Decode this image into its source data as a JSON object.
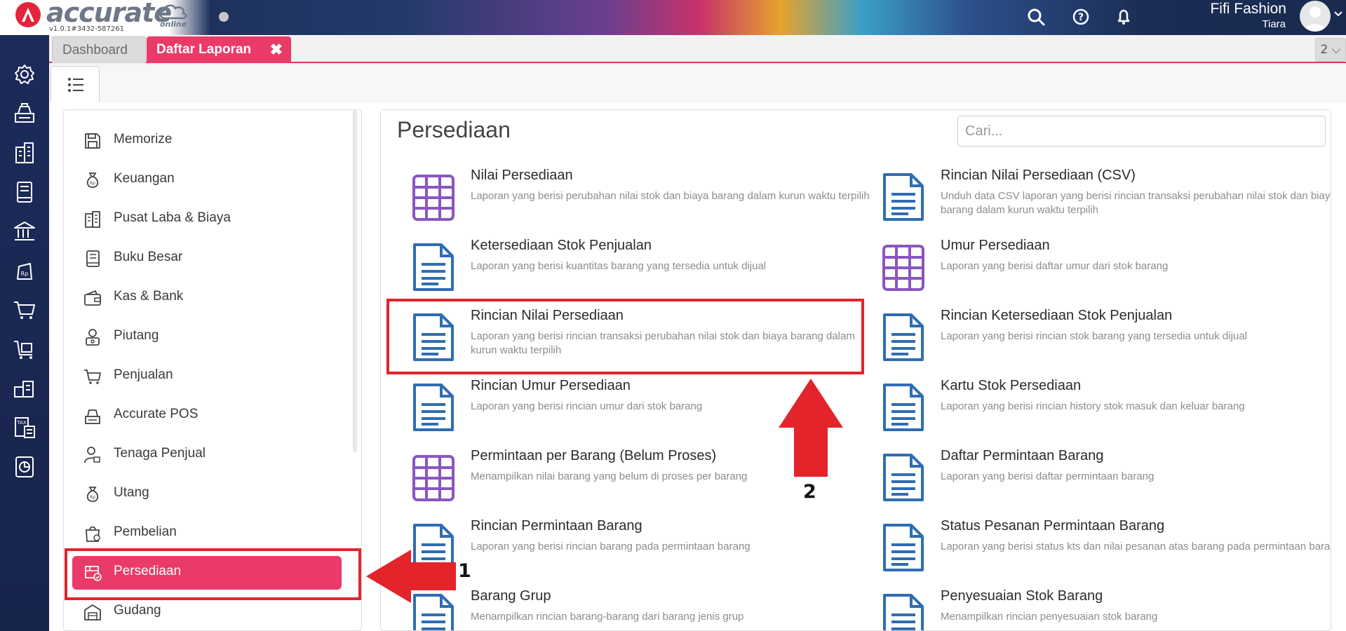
{
  "app": {
    "logo_text": "accurate",
    "logo_sub": "online",
    "version": "v1.0.1#3432-587261"
  },
  "user": {
    "name": "Fifi Fashion",
    "role": "Tiara"
  },
  "tabs": [
    {
      "label": "Dashboard",
      "active": false
    },
    {
      "label": "Daftar Laporan",
      "active": true,
      "close": "✖"
    }
  ],
  "tab_count": "2 ⌵",
  "rail_icons": [
    "settings-icon",
    "cash-register-icon",
    "company-icon",
    "book-icon",
    "bank-icon",
    "receivable-icon",
    "cart-icon",
    "purchase-icon",
    "inventory-icon",
    "tax-icon",
    "report-icon"
  ],
  "sidebar": {
    "items": [
      {
        "label": "Memorize",
        "icon": "save-icon"
      },
      {
        "label": "Keuangan",
        "icon": "money-bag-icon"
      },
      {
        "label": "Pusat Laba & Biaya",
        "icon": "building-icon"
      },
      {
        "label": "Buku Besar",
        "icon": "ledger-icon"
      },
      {
        "label": "Kas & Bank",
        "icon": "wallet-icon"
      },
      {
        "label": "Piutang",
        "icon": "receivable-icon"
      },
      {
        "label": "Penjualan",
        "icon": "cart-icon"
      },
      {
        "label": "Accurate POS",
        "icon": "pos-icon"
      },
      {
        "label": "Tenaga Penjual",
        "icon": "salesperson-icon"
      },
      {
        "label": "Utang",
        "icon": "debt-icon"
      },
      {
        "label": "Pembelian",
        "icon": "purchase-bag-icon"
      },
      {
        "label": "Persediaan",
        "icon": "inventory-box-icon",
        "active": true
      },
      {
        "label": "Gudang",
        "icon": "warehouse-icon"
      }
    ]
  },
  "content": {
    "title": "Persediaan",
    "search_placeholder": "Cari...",
    "reports": [
      {
        "title": "Nilai Persediaan",
        "desc": "Laporan yang berisi perubahan nilai stok dan biaya barang dalam kurun waktu terpilih",
        "icon": "grid-icon"
      },
      {
        "title": "Rincian Nilai Persediaan (CSV)",
        "desc": "Unduh data CSV laporan yang berisi rincian transaksi perubahan nilai stok dan biaya barang dalam kurun waktu terpilih",
        "icon": "document-icon"
      },
      {
        "title": "Ketersediaan Stok Penjualan",
        "desc": "Laporan yang berisi kuantitas barang yang tersedia untuk dijual",
        "icon": "document-icon"
      },
      {
        "title": "Umur Persediaan",
        "desc": "Laporan yang berisi daftar umur dari stok barang",
        "icon": "grid-icon"
      },
      {
        "title": "Rincian Nilai Persediaan",
        "desc": "Laporan yang berisi rincian transaksi perubahan nilai stok dan biaya barang dalam kurun waktu terpilih",
        "icon": "document-icon"
      },
      {
        "title": "Rincian Ketersediaan Stok Penjualan",
        "desc": "Laporan yang berisi rincian stok barang yang tersedia untuk dijual",
        "icon": "document-icon"
      },
      {
        "title": "Rincian Umur Persediaan",
        "desc": "Laporan yang berisi rincian umur dari stok barang",
        "icon": "document-icon"
      },
      {
        "title": "Kartu Stok Persediaan",
        "desc": "Laporan yang berisi rincian history stok masuk dan keluar barang",
        "icon": "document-icon"
      },
      {
        "title": "Permintaan per Barang (Belum Proses)",
        "desc": "Menampilkan nilai barang yang belum di proses per barang",
        "icon": "grid-icon"
      },
      {
        "title": "Daftar Permintaan Barang",
        "desc": "Laporan yang berisi daftar permintaan barang",
        "icon": "document-icon"
      },
      {
        "title": "Rincian Permintaan Barang",
        "desc": "Laporan yang berisi rincian barang pada permintaan barang",
        "icon": "document-icon"
      },
      {
        "title": "Status Pesanan Permintaan Barang",
        "desc": "Laporan yang berisi status kts dan nilai pesanan atas barang pada permintaan barang",
        "icon": "document-icon"
      },
      {
        "title": "Barang Grup",
        "desc": "Menampilkan rincian barang-barang dari barang jenis grup",
        "icon": "document-icon"
      },
      {
        "title": "Penyesuaian Stok Barang",
        "desc": "Menampilkan rincian penyesuaian stok barang",
        "icon": "document-icon"
      }
    ]
  },
  "annotations": {
    "step1": "1",
    "step2": "2"
  },
  "colors": {
    "accent": "#e93a68",
    "rail": "#1c2b5a",
    "doc_icon": "#2f6db3",
    "grid_icon": "#8a56c2",
    "annotation": "#e3242b"
  }
}
